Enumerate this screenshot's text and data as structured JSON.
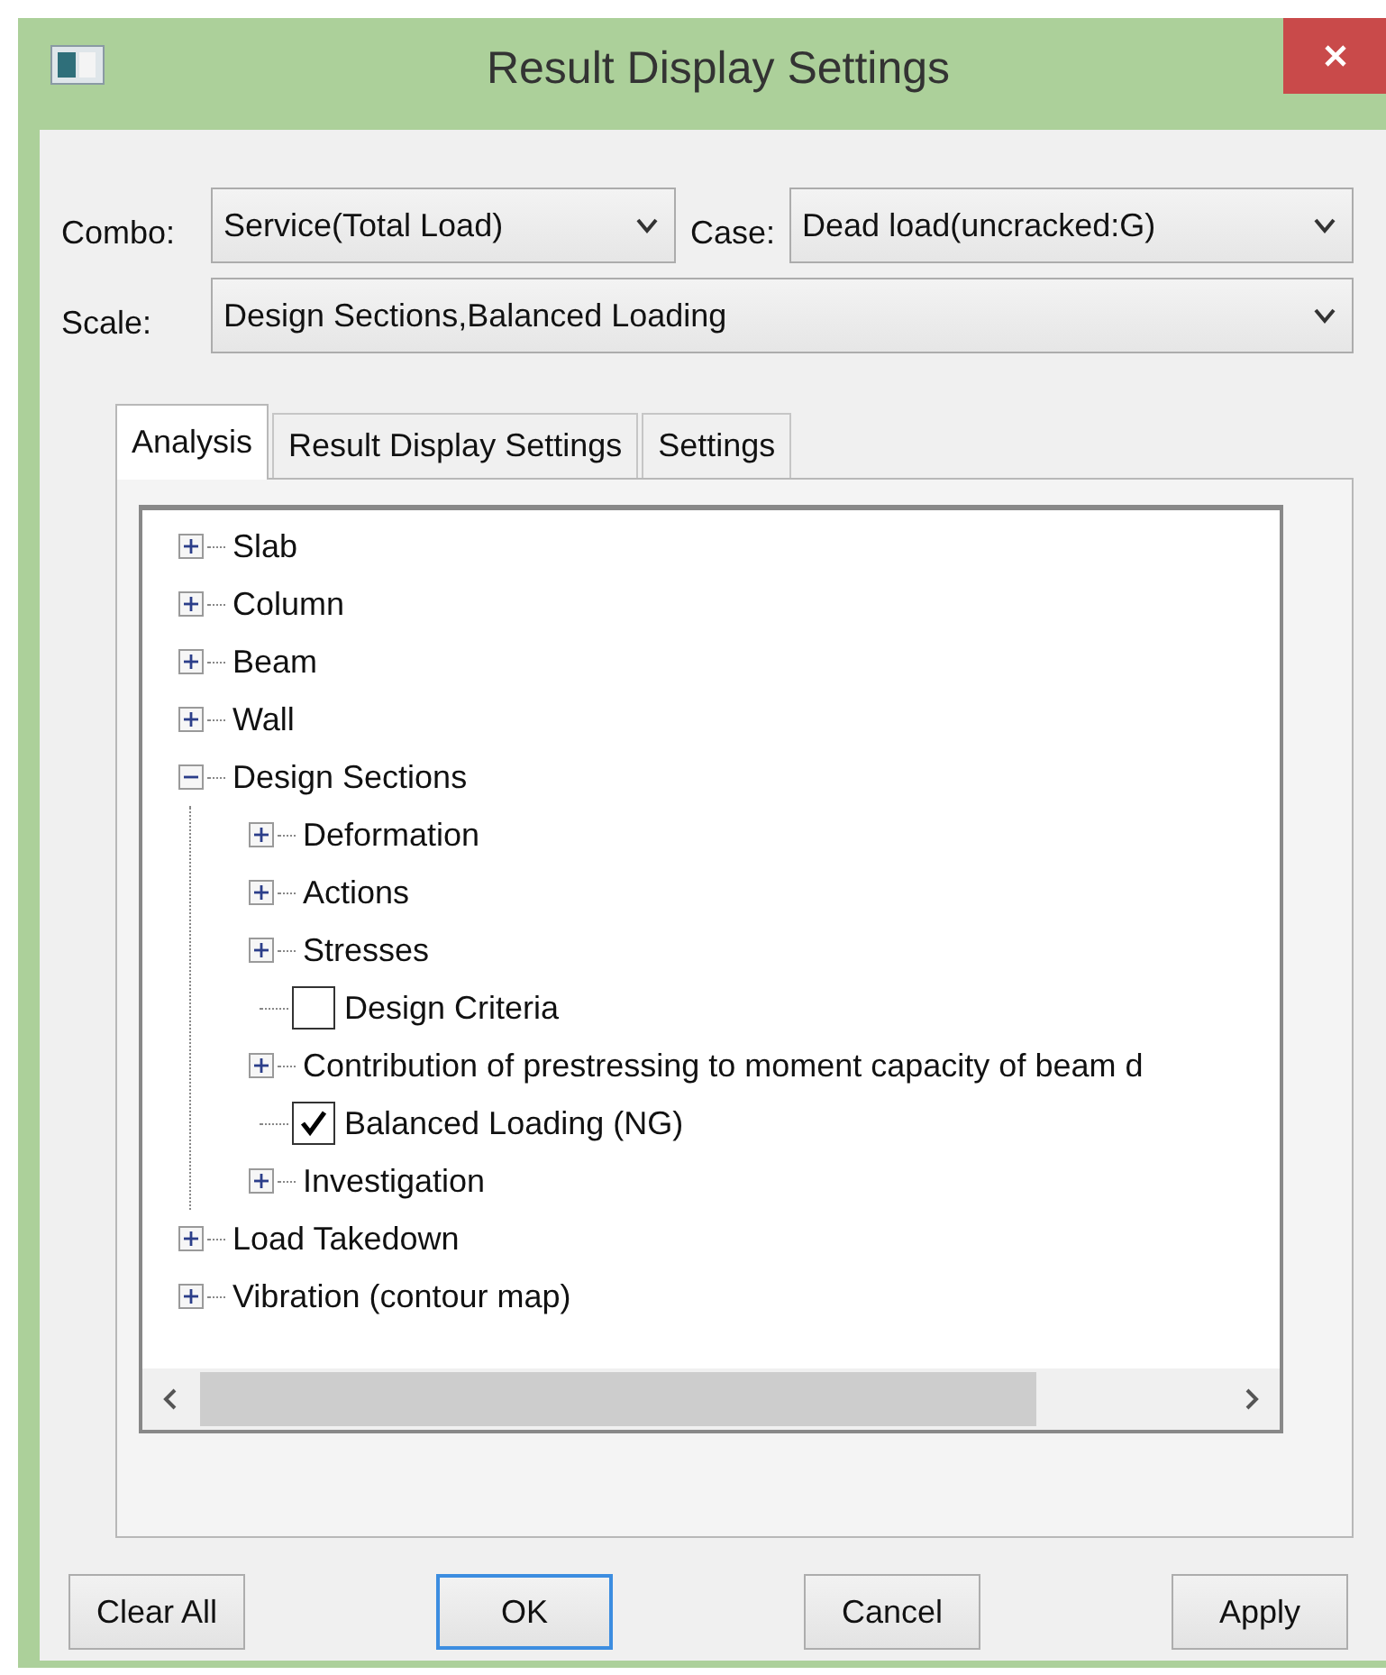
{
  "window": {
    "title": "Result Display Settings"
  },
  "fields": [
    {
      "label": "Combo:",
      "value": "Service(Total Load)"
    },
    {
      "label": "Case:",
      "value": "Dead load(uncracked:G)"
    },
    {
      "label": "Scale:",
      "value": "Design Sections,Balanced Loading"
    }
  ],
  "tabs": [
    {
      "label": "Analysis",
      "selected": true
    },
    {
      "label": "Result Display Settings",
      "selected": false
    },
    {
      "label": "Settings",
      "selected": false
    }
  ],
  "tree": [
    {
      "kind": "node",
      "label": "Slab",
      "expanded": false
    },
    {
      "kind": "node",
      "label": "Column",
      "expanded": false
    },
    {
      "kind": "node",
      "label": "Beam",
      "expanded": false
    },
    {
      "kind": "node",
      "label": "Wall",
      "expanded": false
    },
    {
      "kind": "node",
      "label": "Design Sections",
      "expanded": true,
      "children": [
        {
          "kind": "node",
          "label": "Deformation",
          "expanded": false
        },
        {
          "kind": "node",
          "label": "Actions",
          "expanded": false
        },
        {
          "kind": "node",
          "label": "Stresses",
          "expanded": false
        },
        {
          "kind": "check",
          "label": "Design Criteria",
          "checked": false
        },
        {
          "kind": "node",
          "label": "Contribution of prestressing to moment capacity of beam d",
          "expanded": false
        },
        {
          "kind": "check",
          "label": "Balanced Loading (NG)",
          "checked": true
        },
        {
          "kind": "node",
          "label": "Investigation",
          "expanded": false
        }
      ]
    },
    {
      "kind": "node",
      "label": "Load Takedown",
      "expanded": false
    },
    {
      "kind": "node",
      "label": "Vibration (contour map)",
      "expanded": false
    }
  ],
  "buttons": [
    {
      "label": "Clear All",
      "default": false
    },
    {
      "label": "OK",
      "default": true
    },
    {
      "label": "Cancel",
      "default": false
    },
    {
      "label": "Apply",
      "default": false
    }
  ]
}
